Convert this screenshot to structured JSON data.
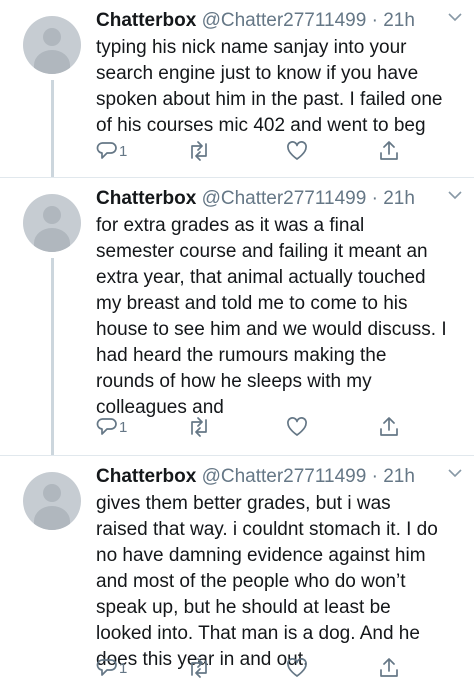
{
  "tweets": [
    {
      "name": "Chatterbox",
      "handle": "@Chatter27711499",
      "separator": "·",
      "time": "21h",
      "lines": [
        "typing his nick name sanjay into your",
        "search engine just to know if you have",
        "spoken about him in the past. I failed one",
        "of his courses mic 402 and went to beg"
      ],
      "reply_count": "1"
    },
    {
      "name": "Chatterbox",
      "handle": "@Chatter27711499",
      "separator": "·",
      "time": "21h",
      "lines": [
        "for extra grades as it was a final",
        "semester course and failing it meant an",
        "extra year, that animal actually touched",
        "my breast and told me to come to his",
        "house to see him and we would discuss. I",
        "had heard the rumours making the",
        "rounds of how he sleeps with my",
        "colleagues and"
      ],
      "reply_count": "1"
    },
    {
      "name": "Chatterbox",
      "handle": "@Chatter27711499",
      "separator": "·",
      "time": "21h",
      "lines": [
        "gives them better grades, but i was",
        "raised that way. i couldnt stomach it. I do",
        "no have damning evidence against him",
        "and most of the people who do won’t",
        "speak up, but he should at least be",
        "looked into. That man is a dog. And he",
        "does this year in and out."
      ],
      "reply_count": "1"
    }
  ],
  "icons": {
    "reply": "reply-icon",
    "retweet": "retweet-icon",
    "like": "heart-icon",
    "share": "share-icon",
    "caret": "chevron-down-icon"
  },
  "colors": {
    "text": "#14171a",
    "secondary": "#657786",
    "thread_line": "#ccd6dd",
    "avatar": "#c6ccd2"
  }
}
